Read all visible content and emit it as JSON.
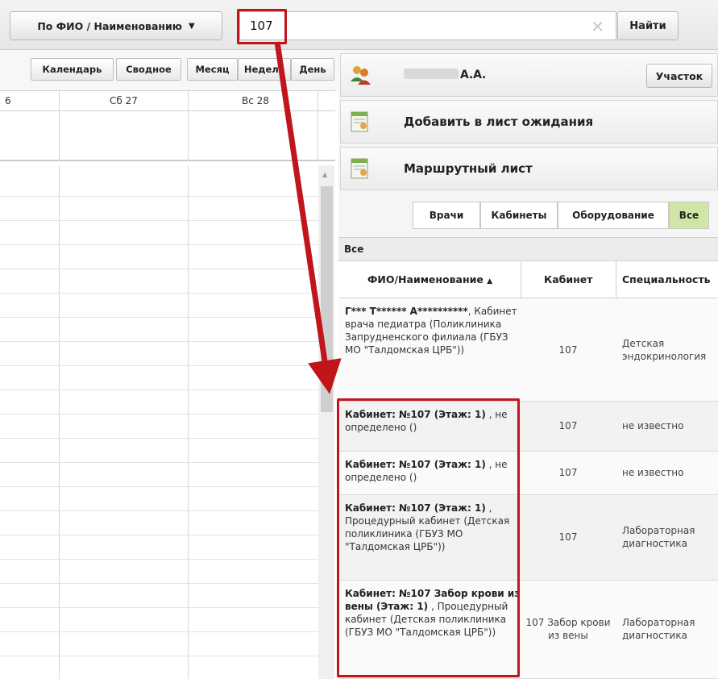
{
  "search": {
    "mode_label": "По ФИО / Наименованию",
    "query": "107",
    "button_label": "Найти"
  },
  "calendar": {
    "tabs": [
      "Календарь",
      "Сводное",
      "Месяц",
      "Неделя",
      "День"
    ],
    "columns": [
      "6",
      "Сб 27",
      "Вс 28"
    ]
  },
  "patient": {
    "name": "А.А.",
    "district_button": "Участок"
  },
  "actions": {
    "waitlist": "Добавить в лист ожидания",
    "route": "Маршрутный лист"
  },
  "resource_tabs": [
    "Врачи",
    "Кабинеты",
    "Оборудование",
    "Все"
  ],
  "grid": {
    "label": "Все",
    "headers": [
      "ФИО/Наименование",
      "Кабинет",
      "Специальность"
    ],
    "rows": [
      {
        "name_bold": "Г*** Т****** А**********",
        "name_rest": ", Кабинет врача педиатра (Поликлиника Запрудненского филиала (ГБУЗ МО \"Талдомская ЦРБ\"))",
        "cabinet": "107",
        "specialty": "Детская эндокринология"
      },
      {
        "name_bold": "Кабинет: №107 (Этаж: 1)",
        "name_rest": " , не определено ()",
        "cabinet": "107",
        "specialty": "не известно"
      },
      {
        "name_bold": "Кабинет: №107 (Этаж: 1)",
        "name_rest": " , не определено ()",
        "cabinet": "107",
        "specialty": "не известно"
      },
      {
        "name_bold": "Кабинет: №107 (Этаж: 1)",
        "name_rest": " , Процедурный кабинет (Детская поликлиника (ГБУЗ МО \"Талдомская ЦРБ\"))",
        "cabinet": "107",
        "specialty": "Лабораторная диагностика"
      },
      {
        "name_bold": "Кабинет: №107 Забор крови из вены (Этаж: 1)",
        "name_rest": " , Процедурный кабинет (Детская поликлиника (ГБУЗ МО \"Талдомская ЦРБ\"))",
        "cabinet": "107 Забор крови из вены",
        "specialty": "Лабораторная диагностика"
      }
    ]
  },
  "colors": {
    "highlight": "#c0151b",
    "active_tab": "#cfe6a6"
  }
}
